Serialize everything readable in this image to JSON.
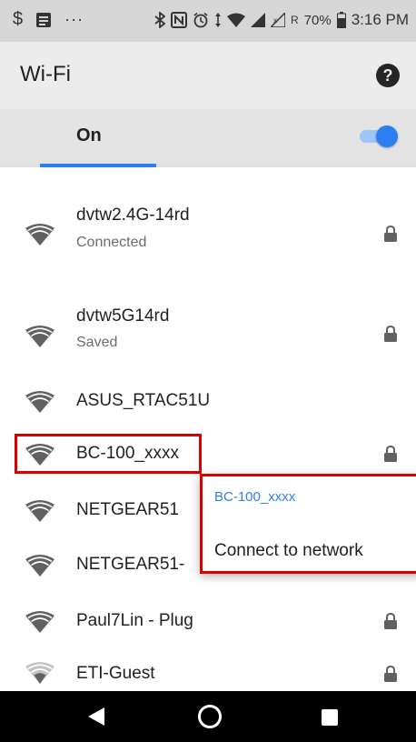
{
  "status_bar": {
    "left_icons": [
      "dollar-sign-icon",
      "notes-icon",
      "more-dots-icon"
    ],
    "right_icons": [
      "bluetooth-icon",
      "nfc-icon",
      "alarm-icon",
      "data-arrows-icon",
      "wifi-signal-icon",
      "cell-signal-icon",
      "cell-signal-no-service-icon"
    ],
    "roaming": "R",
    "battery": "70%",
    "time": "3:16 PM"
  },
  "app_bar": {
    "title": "Wi-Fi",
    "help_icon": "help-icon"
  },
  "wifi_toggle": {
    "label": "On",
    "state": true,
    "accent_color": "#2d7ef0"
  },
  "networks": [
    {
      "name": "dvtw2.4G-14rd",
      "status": "Connected",
      "locked": true,
      "signal": "full"
    },
    {
      "name": "dvtw5G14rd",
      "status": "Saved",
      "locked": true,
      "signal": "full"
    },
    {
      "name": "ASUS_RTAC51U",
      "status": "",
      "locked": false,
      "signal": "full"
    },
    {
      "name": "BC-100_xxxx",
      "status": "",
      "locked": true,
      "signal": "full",
      "highlighted": true
    },
    {
      "name": "NETGEAR51",
      "status": "",
      "locked": false,
      "signal": "full"
    },
    {
      "name": "NETGEAR51-",
      "status": "",
      "locked": false,
      "signal": "full"
    },
    {
      "name": "Paul7Lin - Plug",
      "status": "",
      "locked": true,
      "signal": "full"
    },
    {
      "name": "ETI-Guest",
      "status": "",
      "locked": true,
      "signal": "weak"
    }
  ],
  "context_menu": {
    "title": "BC-100_xxxx",
    "action": "Connect to network",
    "highlight_color": "#d90000"
  },
  "nav_bar": {
    "icons": [
      "back-icon",
      "home-icon",
      "recents-icon"
    ]
  }
}
